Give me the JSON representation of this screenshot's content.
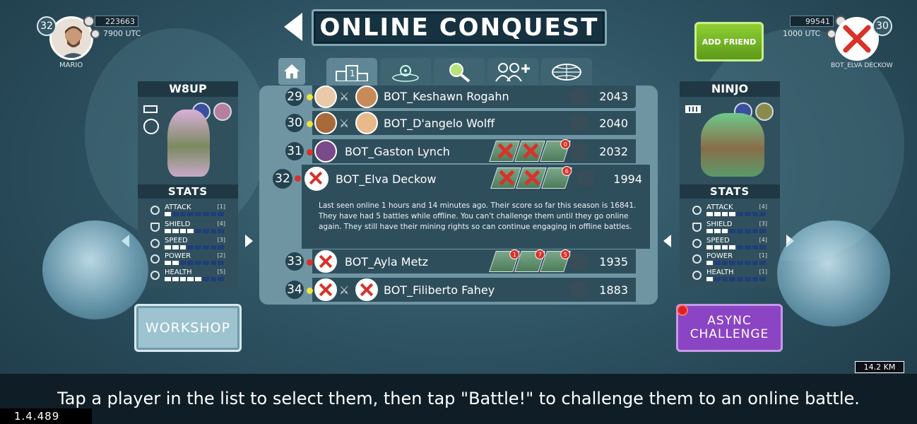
{
  "header": {
    "title": "ONLINE CONQUEST"
  },
  "player_left": {
    "level": "32",
    "name": "MARIO",
    "score": "223663",
    "coins": "7900 UTC"
  },
  "player_right": {
    "level": "30",
    "name": "BOT_ELVA DECKOW",
    "score": "99541",
    "coins": "1000 UTC"
  },
  "buttons": {
    "add_friend": "ADD FRIEND",
    "workshop": "WORKSHOP",
    "async_challenge": "ASYNC CHALLENGE"
  },
  "left_panel": {
    "name": "W8UP",
    "stats_title": "STATS",
    "stats": [
      {
        "label": "ATTACK",
        "value": "[1]",
        "level": 1
      },
      {
        "label": "SHIELD",
        "value": "[4]",
        "level": 4
      },
      {
        "label": "SPEED",
        "value": "[3]",
        "level": 3
      },
      {
        "label": "POWER",
        "value": "[2]",
        "level": 2
      },
      {
        "label": "HEALTH",
        "value": "[5]",
        "level": 5
      }
    ]
  },
  "right_panel": {
    "name": "NINJO",
    "stats_title": "STATS",
    "stats": [
      {
        "label": "ATTACK",
        "value": "[4]",
        "level": 4
      },
      {
        "label": "SHIELD",
        "value": "[3]",
        "level": 3
      },
      {
        "label": "SPEED",
        "value": "[4]",
        "level": 4
      },
      {
        "label": "POWER",
        "value": "[1]",
        "level": 1
      },
      {
        "label": "HEALTH",
        "value": "[1]",
        "level": 1
      }
    ]
  },
  "leaderboard": [
    {
      "rank": "29",
      "name": "BOT_Keshawn Rogahn",
      "score": "2043",
      "status": "yellow"
    },
    {
      "rank": "30",
      "name": "BOT_D'angelo Wolff",
      "score": "2040",
      "status": "yellow"
    },
    {
      "rank": "31",
      "name": "BOT_Gaston Lynch",
      "score": "2032",
      "status": "red",
      "battle_count": "0"
    },
    {
      "rank": "32",
      "name": "BOT_Elva Deckow",
      "score": "1994",
      "status": "red",
      "battle_count": "6"
    },
    {
      "rank": "33",
      "name": "BOT_Ayla Metz",
      "score": "1935",
      "status": "red",
      "battle_counts": [
        "1",
        "7",
        "5"
      ]
    },
    {
      "rank": "34",
      "name": "BOT_Filiberto Fahey",
      "score": "1883",
      "status": "yellow"
    }
  ],
  "selected_info": "Last seen online 1 hours and 14 minutes ago.  Their score so far this season is 16841. They have had 5 battles while offline. You can't challenge them until they go online again. They still have their mining rights so can continue engaging in offline battles.",
  "footer": {
    "hint": "Tap a player in the list to select them, then tap \"Battle!\" to challenge them to an online battle.",
    "version": "1.4.489",
    "distance": "14.2 KM"
  },
  "colors": {
    "status_yellow": "#f2e33a",
    "status_red": "#d8322a",
    "accent_green": "#7bc12a",
    "accent_purple": "#8a44c4"
  },
  "icons": {
    "back": "back-arrow-icon",
    "home": "home-icon",
    "tabs": [
      "podium-icon",
      "radar-icon",
      "search-icon",
      "add-group-icon",
      "globe-icon"
    ]
  }
}
